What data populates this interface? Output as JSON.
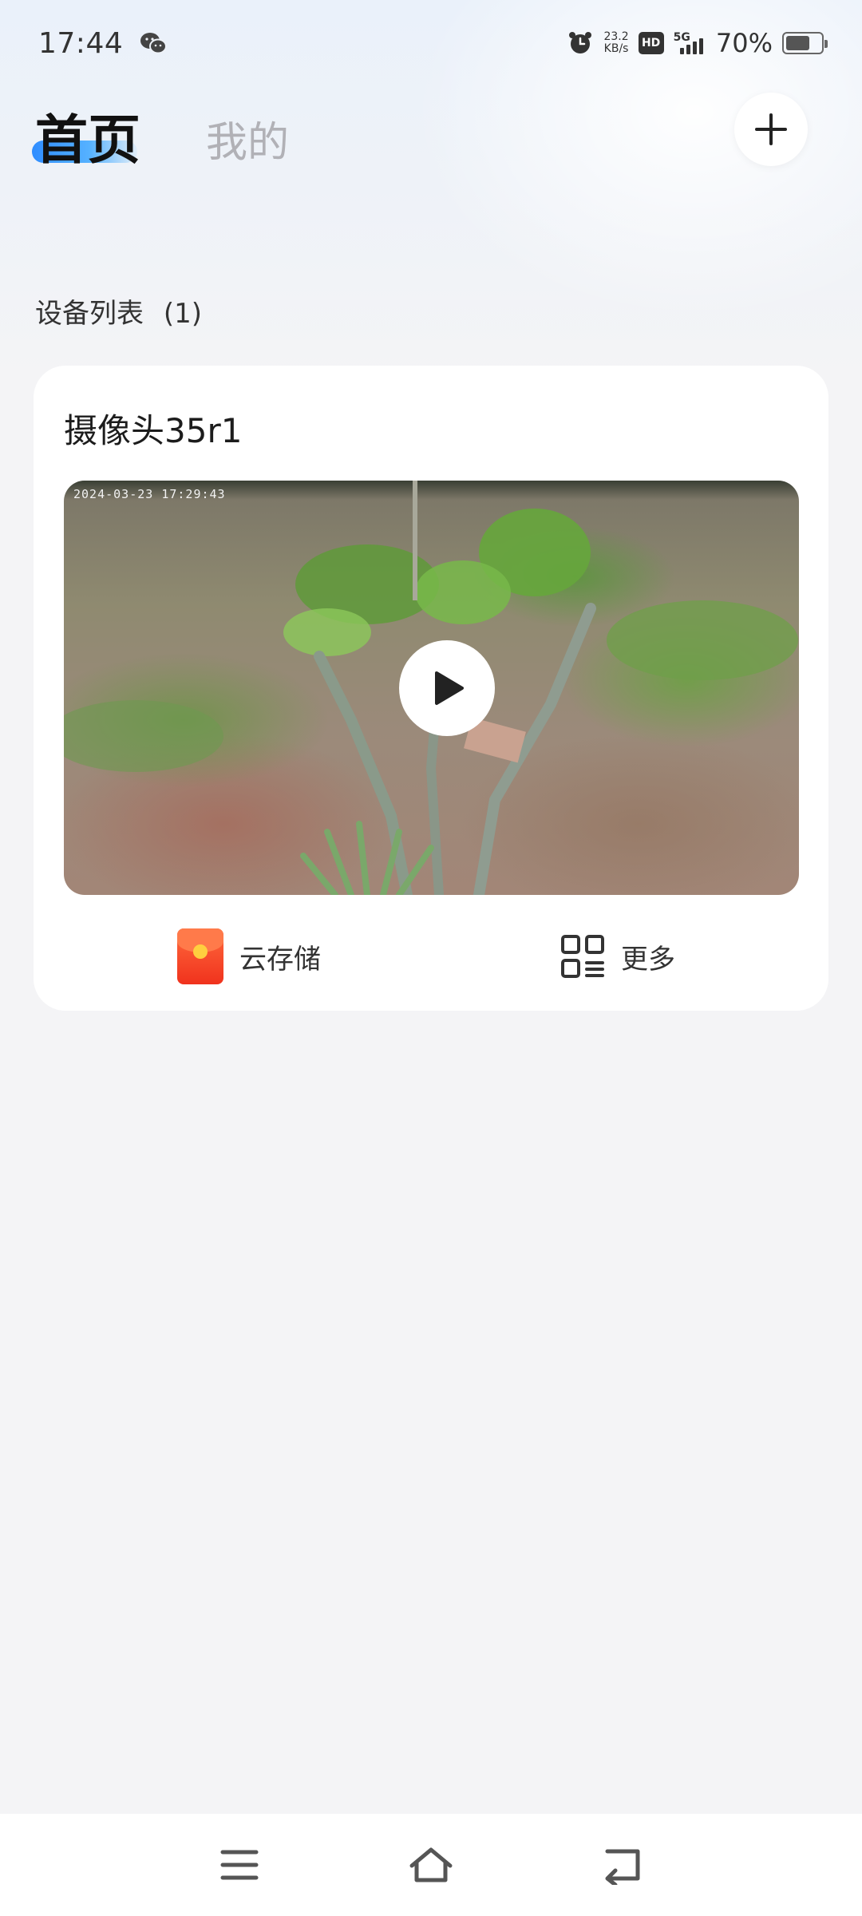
{
  "status_bar": {
    "time": "17:44",
    "net_speed_value": "23.2",
    "net_speed_unit": "KB/s",
    "hd_label": "HD",
    "network_type": "5G",
    "battery_percent": "70%",
    "battery_level": 0.7
  },
  "header": {
    "tabs": [
      {
        "label": "首页",
        "active": true
      },
      {
        "label": "我的",
        "active": false
      }
    ],
    "add_icon": "plus-icon"
  },
  "device_list": {
    "title": "设备列表",
    "count_label": "(1)",
    "devices": [
      {
        "name": "摄像头35r1",
        "preview_timestamp": "2024-03-23 17:29:43",
        "actions": [
          {
            "label": "云存储",
            "icon": "red-packet-icon"
          },
          {
            "label": "更多",
            "icon": "grid-more-icon"
          }
        ]
      }
    ]
  },
  "nav_bar": {
    "icons": [
      "menu-icon",
      "home-icon",
      "back-icon"
    ]
  },
  "colors": {
    "accent": "#2f8dff",
    "inactive_tab": "#b1b1b6",
    "card_bg": "#ffffff",
    "page_bg": "#f4f4f6"
  }
}
